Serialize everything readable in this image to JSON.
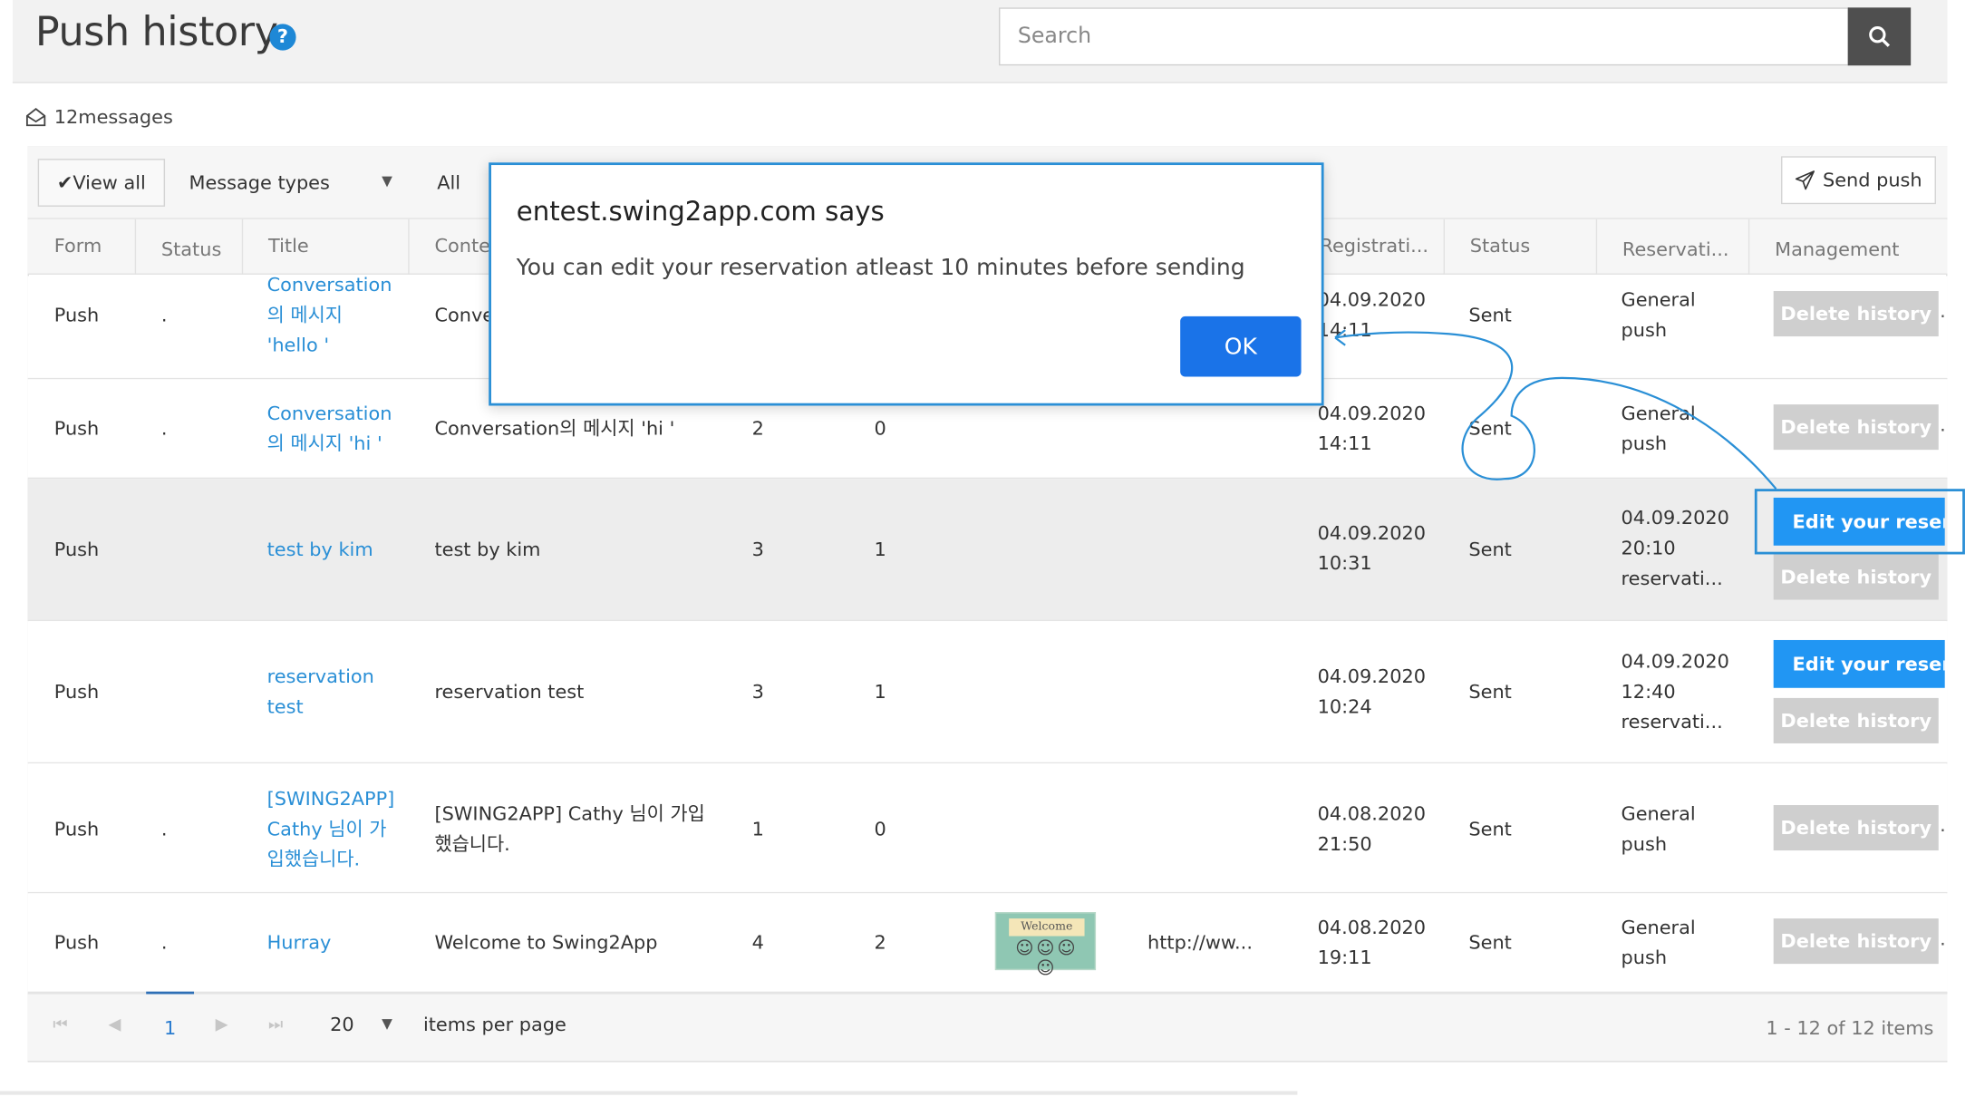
{
  "header": {
    "title": "Push history",
    "help_icon": "?",
    "search_placeholder": "Search"
  },
  "summary": {
    "count_label": "12messages"
  },
  "toolbar": {
    "view_all": "View all",
    "message_types": "Message types",
    "filter_value": "All",
    "send_push": "Send push"
  },
  "columns": {
    "form": "Form",
    "status": "Status",
    "title": "Title",
    "content": "Conte",
    "registration": "Registrati...",
    "status2": "Status",
    "reservation": "Reservati...",
    "management": "Management"
  },
  "rows": [
    {
      "form": "Push",
      "status": ".",
      "title": [
        "Conversation",
        "의 메시지",
        "'hello '"
      ],
      "content": "Conve",
      "col_a": "",
      "col_b": "",
      "link": "",
      "reg": [
        "04.09.2020",
        "14:11"
      ],
      "status2": "Sent",
      "reservation": [
        "General",
        "push"
      ],
      "delete": "Delete history",
      "edit": "",
      "more": "."
    },
    {
      "form": "Push",
      "status": ".",
      "title": [
        "Conversation",
        "의 메시지 'hi '"
      ],
      "content": "Conversation의 메시지 'hi '",
      "col_a": "2",
      "col_b": "0",
      "link": "",
      "reg": [
        "04.09.2020",
        "14:11"
      ],
      "status2": "Sent",
      "reservation": [
        "General",
        "push"
      ],
      "delete": "Delete history",
      "edit": "",
      "more": "."
    },
    {
      "form": "Push",
      "status": "",
      "title": [
        "test by kim"
      ],
      "content": "test by kim",
      "col_a": "3",
      "col_b": "1",
      "link": "",
      "reg": [
        "04.09.2020",
        "10:31"
      ],
      "status2": "Sent",
      "reservation": [
        "04.09.2020",
        "20:10",
        "reservati..."
      ],
      "delete": "Delete history",
      "edit": "Edit your reserva",
      "more": ""
    },
    {
      "form": "Push",
      "status": "",
      "title": [
        "reservation",
        "test"
      ],
      "content": "reservation test",
      "col_a": "3",
      "col_b": "1",
      "link": "",
      "reg": [
        "04.09.2020",
        "10:24"
      ],
      "status2": "Sent",
      "reservation": [
        "04.09.2020",
        "12:40",
        "reservati..."
      ],
      "delete": "Delete history",
      "edit": "Edit your reserva",
      "more": ""
    },
    {
      "form": "Push",
      "status": ".",
      "title": [
        "[SWING2APP]",
        "Cathy 님이 가",
        "입했습니다."
      ],
      "content": [
        "[SWING2APP] Cathy 님이 가입",
        "했습니다."
      ],
      "col_a": "1",
      "col_b": "0",
      "link": "",
      "reg": [
        "04.08.2020",
        "21:50"
      ],
      "status2": "Sent",
      "reservation": [
        "General",
        "push"
      ],
      "delete": "Delete history",
      "edit": "",
      "more": "."
    },
    {
      "form": "Push",
      "status": ".",
      "title": [
        "Hurray"
      ],
      "content": "Welcome to Swing2App",
      "col_a": "4",
      "col_b": "2",
      "image_text": "Welcome",
      "link": "http://ww...",
      "reg": [
        "04.08.2020",
        "19:11"
      ],
      "status2": "Sent",
      "reservation": [
        "General",
        "push"
      ],
      "delete": "Delete history",
      "edit": "",
      "more": "."
    }
  ],
  "pager": {
    "current_page": "1",
    "per_page": "20",
    "per_page_label": "items per page",
    "range": "1 - 12 of 12 items"
  },
  "dialog": {
    "title": "entest.swing2app.com says",
    "message": "You can edit your reservation atleast 10 minutes before sending",
    "ok": "OK"
  },
  "colors": {
    "accent": "#2196f3",
    "link": "#2a8fd6",
    "delete_button": "#cfcfcf",
    "dialog_ok": "#1a73e8"
  }
}
